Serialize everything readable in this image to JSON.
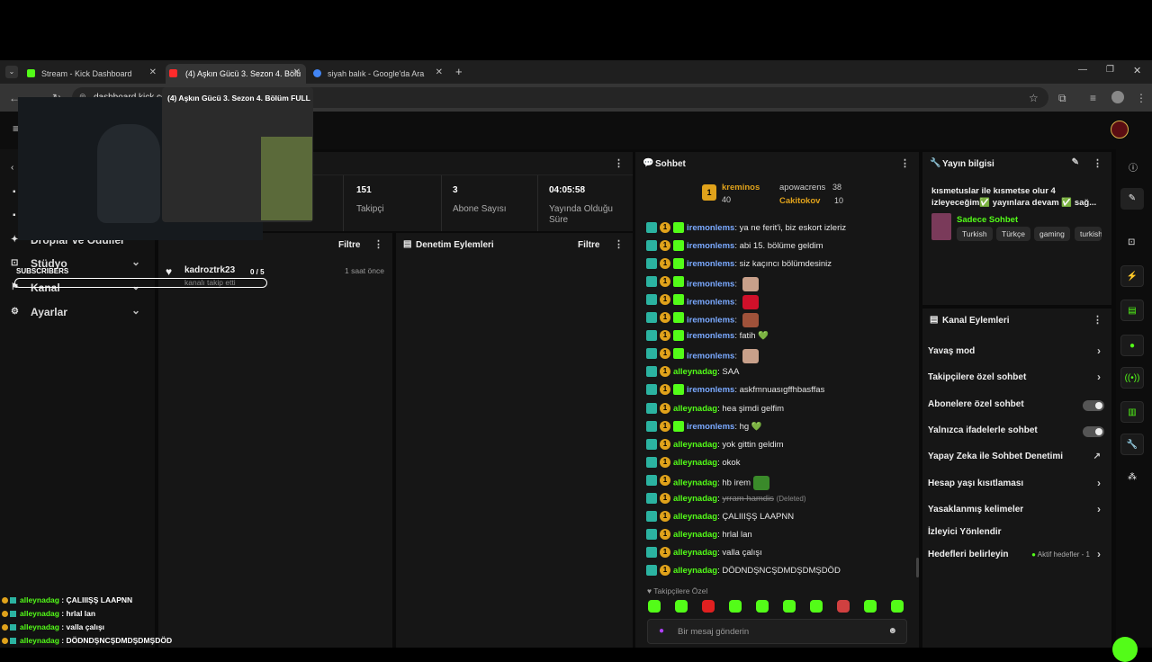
{
  "browser": {
    "tabs": [
      {
        "title": "Stream - Kick Dashboard",
        "favicon_color": "#53fc18"
      },
      {
        "title": "(4) Aşkın Gücü 3. Sezon 4. Bölü",
        "favicon_color": "#ff2b2b"
      },
      {
        "title": "siyah balık - Google'da Ara",
        "favicon_color": "#4285f4"
      }
    ],
    "new_tab": "+",
    "url": "dashboard.kick.co"
  },
  "tooltip": {
    "title": "(4) Aşkın Gücü 3. Sezon 4. Bölüm FULL"
  },
  "webcam": {
    "label": "SUBSCRIBERS"
  },
  "sidebar": {
    "items": [
      {
        "label": "Droplar ve Ödüller",
        "icon": "gift-icon"
      },
      {
        "label": "Stüdyo",
        "icon": "studio-icon"
      },
      {
        "label": "Kanal",
        "icon": "channel-icon"
      },
      {
        "label": "Ayarlar",
        "icon": "gear-icon"
      }
    ]
  },
  "stats": [
    {
      "value": "151",
      "label": "Takipçi"
    },
    {
      "value": "3",
      "label": "Abone Sayısı"
    },
    {
      "value": "04:05:58",
      "label": "Yayında Olduğu Süre"
    }
  ],
  "activity": {
    "filter_label": "Filtre",
    "event": {
      "user": "kadroztrk23",
      "goal": "0 / 5",
      "desc": "kanalı takip etti",
      "time": "1 saat önce"
    }
  },
  "moderation": {
    "title": "Denetim Eylemleri",
    "filter_label": "Filtre"
  },
  "chat": {
    "title": "Sohbet",
    "leaderboard": [
      {
        "rank": "1",
        "user": "kreminos",
        "count": "40"
      },
      {
        "user": "apowacrens",
        "count": "38"
      },
      {
        "user": "Cakitokov",
        "count": "10"
      }
    ],
    "messages": [
      {
        "user": "iremonlems",
        "color": "blue",
        "text": "ya ne ferit'i, biz eskort izleriz"
      },
      {
        "user": "iremonlems",
        "color": "blue",
        "text": "abi 15. bölüme geldim"
      },
      {
        "user": "iremonlems",
        "color": "blue",
        "text": "siz kaçıncı bölümdesiniz"
      },
      {
        "user": "iremonlems",
        "color": "blue",
        "text": "",
        "emote": "#c8a08a"
      },
      {
        "user": "iremonlems",
        "color": "blue",
        "text": "",
        "emote": "#d0102a"
      },
      {
        "user": "iremonlems",
        "color": "blue",
        "text": "",
        "emote": "#a0523a"
      },
      {
        "user": "iremonlems",
        "color": "blue",
        "text": "fatih 💚"
      },
      {
        "user": "iremonlems",
        "color": "blue",
        "text": "",
        "emote": "#c8a08a"
      },
      {
        "user": "alleynadag",
        "color": "green",
        "text": "SAA"
      },
      {
        "user": "iremonlems",
        "color": "blue",
        "text": "askfmnuasıgffhbasffas"
      },
      {
        "user": "alleynadag",
        "color": "green",
        "text": "hea şimdi gelfim"
      },
      {
        "user": "iremonlems",
        "color": "blue",
        "text": "hg 💚"
      },
      {
        "user": "alleynadag",
        "color": "green",
        "text": "yok gittin geldim"
      },
      {
        "user": "alleynadag",
        "color": "green",
        "text": "okok"
      },
      {
        "user": "alleynadag",
        "color": "green",
        "text": "hb irem",
        "emote": "#3a8a2a"
      },
      {
        "user": "alleynadag",
        "color": "green",
        "text": "yrram hamdis",
        "deleted": "(Deleted)"
      },
      {
        "user": "alleynadag",
        "color": "green",
        "text": "ÇALIIIŞŞ LAAPNN"
      },
      {
        "user": "alleynadag",
        "color": "green",
        "text": "hrlal lan"
      },
      {
        "user": "alleynadag",
        "color": "green",
        "text": "valla çalışı"
      },
      {
        "user": "alleynadag",
        "color": "green",
        "text": "DÖDNDŞNCŞDMDŞDMŞDÖD"
      }
    ],
    "emote_section": "Takipçilere Özel",
    "input_placeholder": "Bir mesaj gönderin"
  },
  "stream_info": {
    "title": "Yayın bilgisi",
    "stream_title": "kısmetuslar ile kısmetse olur 4 izleyeceğim✅ yayınlara devam ✅ sağ...",
    "category": "Sadece Sohbet",
    "tags": [
      "Turkish",
      "Türkçe",
      "gaming",
      "turkish"
    ]
  },
  "channel_actions": {
    "title": "Kanal Eylemleri",
    "items": [
      {
        "label": "Yavaş mod",
        "control": "arrow"
      },
      {
        "label": "Takipçilere özel sohbet",
        "control": "arrow"
      },
      {
        "label": "Abonelere özel sohbet",
        "control": "toggle"
      },
      {
        "label": "Yalnızca ifadelerle sohbet",
        "control": "toggle"
      },
      {
        "label": "Yapay Zeka ile Sohbet Denetimi",
        "control": "external"
      },
      {
        "label": "Hesap yaşı kısıtlaması",
        "control": "arrow"
      },
      {
        "label": "Yasaklanmış kelimeler",
        "control": "arrow"
      },
      {
        "label": "İzleyici Yönlendir",
        "control": "none"
      },
      {
        "label": "Hedefleri belirleyin",
        "control": "arrow",
        "status": "Aktif hedefler - 1"
      }
    ]
  },
  "overlay_chat": [
    {
      "user": "alleynadag",
      "text": "ÇALIIIŞŞ LAAPNN"
    },
    {
      "user": "alleynadag",
      "text": "hrlal lan"
    },
    {
      "user": "alleynadag",
      "text": "valla çalışı"
    },
    {
      "user": "alleynadag",
      "text": "DÖDNDŞNCŞDMDŞDMŞDÖD"
    }
  ]
}
